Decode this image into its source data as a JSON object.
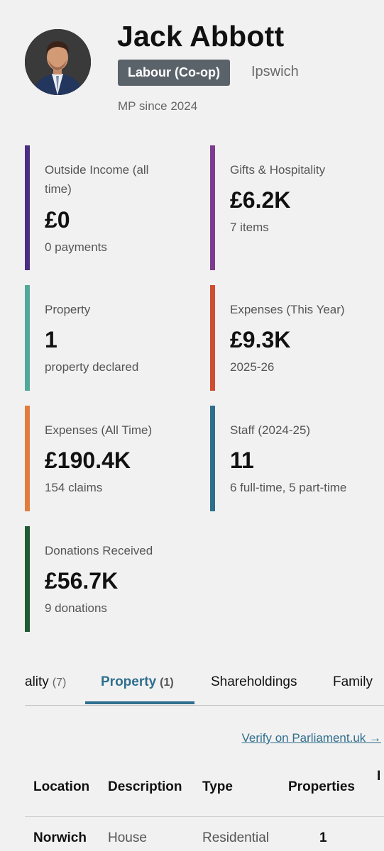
{
  "profile": {
    "name": "Jack Abbott",
    "party": "Labour (Co-op)",
    "constituency": "Ipswich",
    "since": "MP since 2024",
    "avatar_icon": "person-photo"
  },
  "cards": [
    {
      "label": "Outside Income (all time)",
      "value": "£0",
      "sub": "0 payments",
      "color": "#4b2d86"
    },
    {
      "label": "Gifts & Hospitality",
      "value": "£6.2K",
      "sub": "7 items",
      "color": "#7f3a91"
    },
    {
      "label": "Property",
      "value": "1",
      "sub": "property declared",
      "color": "#52a89a"
    },
    {
      "label": "Expenses (This Year)",
      "value": "£9.3K",
      "sub": "2025-26",
      "color": "#cf4e2f"
    },
    {
      "label": "Expenses (All Time)",
      "value": "£190.4K",
      "sub": "154 claims",
      "color": "#e27c3e"
    },
    {
      "label": "Staff (2024-25)",
      "value": "11",
      "sub": "6 full-time, 5 part-time",
      "color": "#2e6e8e"
    },
    {
      "label": "Donations Received",
      "value": "£56.7K",
      "sub": "9 donations",
      "color": "#1f5a34"
    }
  ],
  "tabs": [
    {
      "label": "ality",
      "count": "(7)"
    },
    {
      "label": "Property",
      "count": "(1)",
      "active": true
    },
    {
      "label": "Shareholdings",
      "count": ""
    },
    {
      "label": "Family",
      "count": ""
    }
  ],
  "verify_link": "Verify on Parliament.uk →",
  "table": {
    "headers": [
      "Location",
      "Description",
      "Type",
      "Properties",
      "I"
    ],
    "rows": [
      [
        "Norwich",
        "House",
        "Residential",
        "1"
      ]
    ]
  },
  "colors": {
    "accent": "#2f6f8f",
    "badge_bg": "#5b636a",
    "background": "#f2f1f1"
  }
}
